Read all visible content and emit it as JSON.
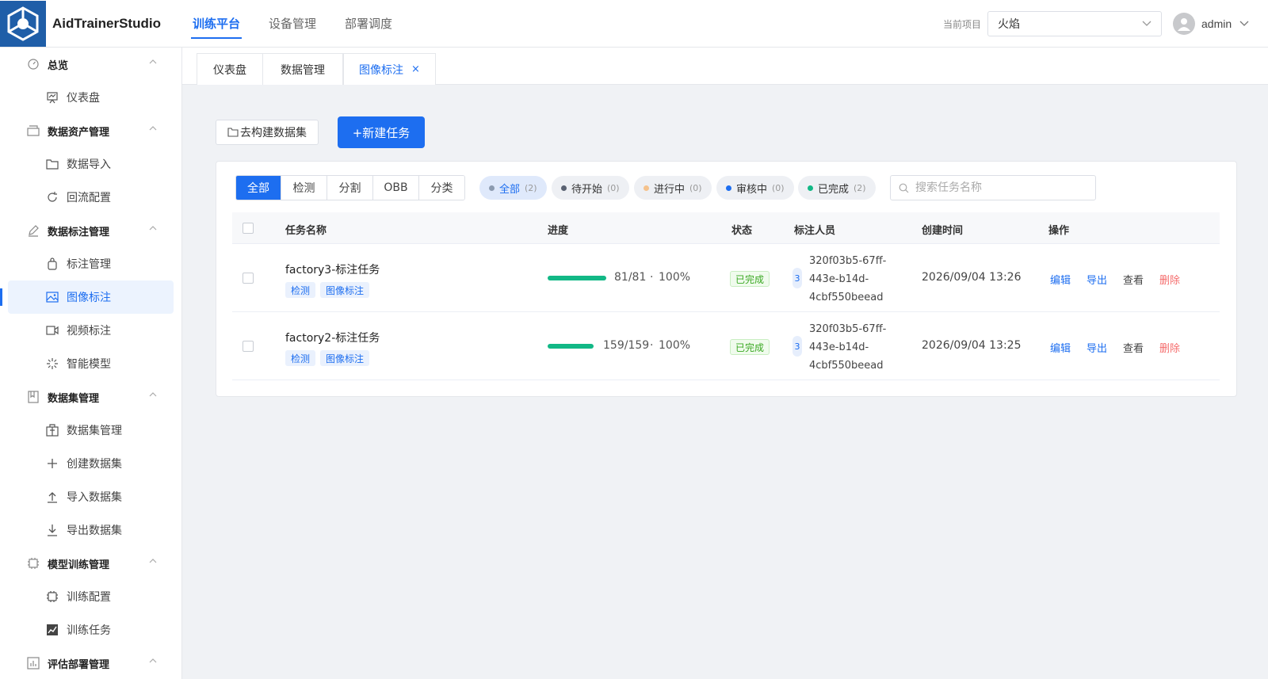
{
  "app": {
    "name": "AidTrainerStudio"
  },
  "top_nav": [
    "训练平台",
    "设备管理",
    "部署调度"
  ],
  "project": {
    "label": "当前项目",
    "value": "火焰"
  },
  "user": {
    "name": "admin"
  },
  "sidebar": {
    "groups": [
      {
        "label": "总览",
        "items": [
          "仪表盘"
        ]
      },
      {
        "label": "数据资产管理",
        "items": [
          "数据导入",
          "回流配置"
        ]
      },
      {
        "label": "数据标注管理",
        "items": [
          "标注管理",
          "图像标注",
          "视频标注",
          "智能模型"
        ]
      },
      {
        "label": "数据集管理",
        "items": [
          "数据集管理",
          "创建数据集",
          "导入数据集",
          "导出数据集"
        ]
      },
      {
        "label": "模型训练管理",
        "items": [
          "训练配置",
          "训练任务"
        ]
      },
      {
        "label": "评估部署管理",
        "items": []
      }
    ]
  },
  "tabs": [
    "仪表盘",
    "数据管理",
    "图像标注"
  ],
  "toolbar": {
    "build_dataset": "去构建数据集",
    "new_task": "+新建任务"
  },
  "type_filter": [
    "全部",
    "检测",
    "分割",
    "OBB",
    "分类"
  ],
  "status_filter": [
    {
      "label": "全部",
      "count": "(2)",
      "color": "#8c9bb0"
    },
    {
      "label": "待开始",
      "count": "(0)",
      "color": "#5a6272"
    },
    {
      "label": "进行中",
      "count": "(0)",
      "color": "#f5c28c"
    },
    {
      "label": "审核中",
      "count": "(0)",
      "color": "#1d6ef0"
    },
    {
      "label": "已完成",
      "count": "(2)",
      "color": "#12b886"
    }
  ],
  "search": {
    "placeholder": "搜索任务名称"
  },
  "table": {
    "headers": [
      "任务名称",
      "进度",
      "状态",
      "标注人员",
      "创建时间",
      "操作"
    ],
    "rows": [
      {
        "name": "factory3-标注任务",
        "tags": [
          "检测",
          "图像标注"
        ],
        "progress_count": "81/81",
        "progress_pct": "100%",
        "progress": 1.0,
        "status": "已完成",
        "annotator_count": "3",
        "annotator_lines": [
          "320f03b5-67ff-",
          "443e-b14d-",
          "4cbf550beead"
        ],
        "created": "2026/09/04 13:26",
        "actions": [
          "编辑",
          "导出",
          "查看",
          "删除"
        ]
      },
      {
        "name": "factory2-标注任务",
        "tags": [
          "检测",
          "图像标注"
        ],
        "progress_count": "159/159",
        "progress_pct": "100%",
        "progress": 1.0,
        "status": "已完成",
        "annotator_count": "3",
        "annotator_lines": [
          "320f03b5-67ff-",
          "443e-b14d-",
          "4cbf550beead"
        ],
        "created": "2026/09/04 13:25",
        "actions": [
          "编辑",
          "导出",
          "查看",
          "删除"
        ]
      }
    ]
  }
}
